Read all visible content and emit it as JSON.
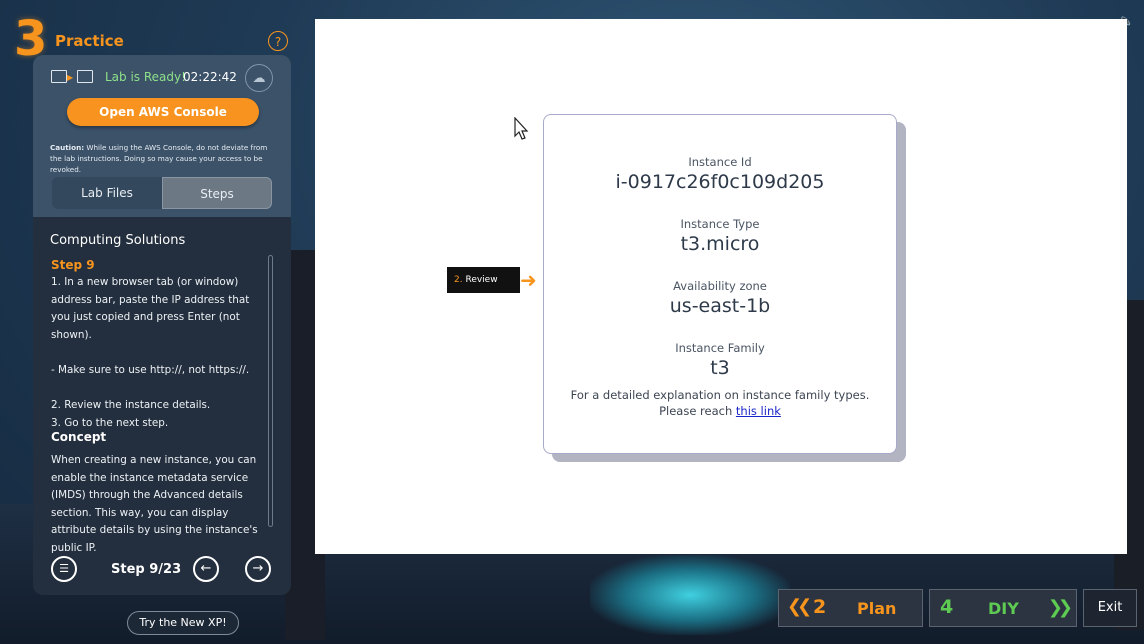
{
  "header": {
    "step_number": "3",
    "title": "Practice",
    "help": "?"
  },
  "lab": {
    "status": "Lab is Ready!",
    "timer": "02:22:42",
    "console_button": "Open AWS Console",
    "caution_label": "Caution:",
    "caution_text": "While using the AWS Console, do not deviate from the lab instructions. Doing so may cause your access to be revoked.",
    "tabs": [
      {
        "label": "Lab Files"
      },
      {
        "label": "Steps"
      }
    ],
    "active_tab": "Steps"
  },
  "steps": {
    "lesson_title": "Computing Solutions",
    "step_label": "Step 9",
    "step_text": "1. In a new browser tab (or window) address bar, paste the IP address that you just copied and press Enter (not shown).\n\n- Make sure to use http://, not https://.\n\n2. Review the instance details.\n3. Go to the next step.",
    "concept_label": "Concept",
    "concept_text": "When creating a new instance, you can enable the instance metadata service (IMDS) through the Advanced details section. This way, you can display attribute details by using the instance's public IP.",
    "counter": "Step 9/23"
  },
  "try_new_xp": "Try the New XP!",
  "callout": {
    "number": "2.",
    "label": "Review"
  },
  "instance_card": {
    "id_label": "Instance Id",
    "id_value": "i-0917c26f0c109d205",
    "type_label": "Instance Type",
    "type_value": "t3.micro",
    "az_label": "Availability zone",
    "az_value": "us-east-1b",
    "family_label": "Instance Family",
    "family_value": "t3",
    "note_line1": "For a detailed explanation on instance family types.",
    "note_line2": "Please reach",
    "link_text": "this link"
  },
  "nav": {
    "plan_number": "2",
    "plan_label": "Plan",
    "diy_number": "4",
    "diy_label": "DIY",
    "exit_label": "Exit"
  },
  "colors": {
    "accent_orange": "#f7941d",
    "accent_green": "#5ecb52",
    "ready_green": "#8fe08a",
    "panel_bg": "#232f3e",
    "link_blue": "#1a25c8"
  },
  "icons": [
    "help-icon",
    "lab-connection-icon",
    "cloud-icon",
    "list-icon",
    "arrow-left-icon",
    "arrow-right-icon",
    "speaker-icon",
    "cursor-icon",
    "chevron-left-icon",
    "chevron-right-icon"
  ]
}
